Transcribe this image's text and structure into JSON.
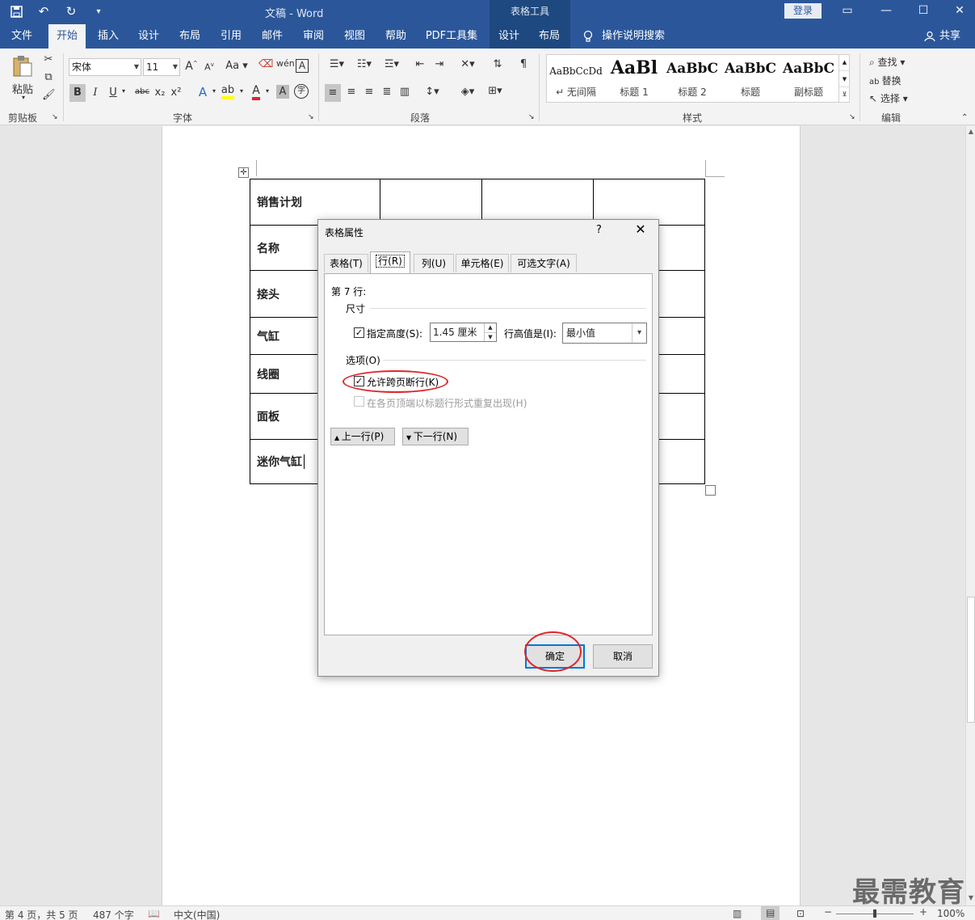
{
  "titlebar": {
    "quick_access": [
      "save-icon",
      "undo-icon",
      "redo-icon",
      "customize-icon"
    ],
    "document_title": "文稿  -  Word",
    "context_tools": "表格工具",
    "login": "登录"
  },
  "tabs": {
    "file": "文件",
    "home": "开始",
    "insert": "插入",
    "design": "设计",
    "layout": "布局",
    "references": "引用",
    "mailings": "邮件",
    "review": "审阅",
    "view": "视图",
    "help": "帮助",
    "pdf": "PDF工具集",
    "table_design": "设计",
    "table_layout": "布局",
    "tell_me": "操作说明搜索",
    "share": "共享"
  },
  "ribbon": {
    "clipboard": {
      "paste": "粘贴",
      "label": "剪贴板"
    },
    "font": {
      "family": "宋体",
      "size": "11",
      "grow": "A",
      "shrink": "A",
      "case": "Aa",
      "bold": "B",
      "italic": "I",
      "underline": "U",
      "strike": "abc",
      "sub": "x₂",
      "sup": "x²",
      "label": "字体"
    },
    "paragraph": {
      "label": "段落"
    },
    "styles": {
      "label": "样式",
      "items": [
        {
          "sample": "AaBbCcDd",
          "name": "↵ 无间隔"
        },
        {
          "sample": "AaBl",
          "name": "标题 1"
        },
        {
          "sample": "AaBbC",
          "name": "标题 2"
        },
        {
          "sample": "AaBbC",
          "name": "标题"
        },
        {
          "sample": "AaBbC",
          "name": "副标题"
        }
      ]
    },
    "editing": {
      "find": "查找",
      "replace": "替换",
      "select": "选择",
      "label": "编辑"
    }
  },
  "document": {
    "rows": [
      "销售计划",
      "名称",
      "接头",
      "气缸",
      "线圈",
      "面板",
      "迷你气缸"
    ]
  },
  "dialog": {
    "title": "表格属性",
    "help": "?",
    "tabs": [
      "表格(T)",
      "行(R)",
      "列(U)",
      "单元格(E)",
      "可选文字(A)"
    ],
    "row_label": "第 7 行:",
    "size_group": "尺寸",
    "specify_height": "指定高度(S):",
    "height_value": "1.45 厘米",
    "height_rule_label": "行高值是(I):",
    "height_rule_value": "最小值",
    "options_group": "选项(O)",
    "allow_break": "允许跨页断行(K)",
    "repeat_header": "在各页顶端以标题行形式重复出现(H)",
    "prev_row": "上一行(P)",
    "next_row": "下一行(N)",
    "ok": "确定",
    "cancel": "取消"
  },
  "statusbar": {
    "page": "第 4 页，共 5 页",
    "words": "487 个字",
    "language": "中文(中国)",
    "zoom_minus": "−",
    "zoom_plus": "+",
    "zoom": "100%"
  },
  "watermark": "最需教育",
  "colors": {
    "titlebar": "#2b579a",
    "context_tab": "#1e4880",
    "annotation": "#e0262b"
  }
}
